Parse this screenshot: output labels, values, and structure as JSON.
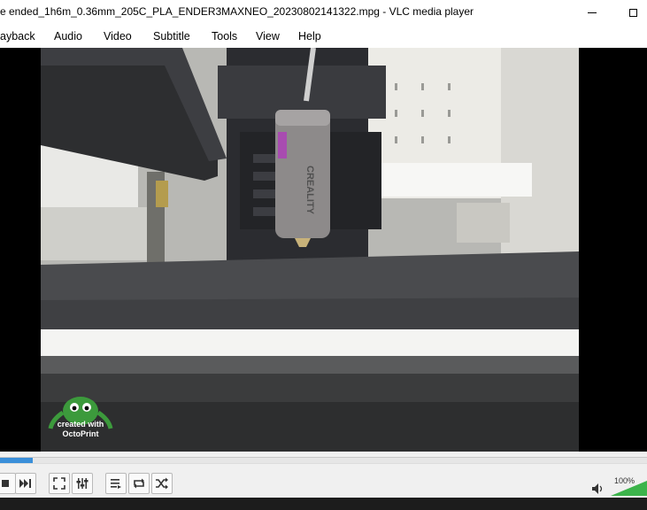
{
  "window": {
    "title": "e ended_1h6m_0.36mm_205C_PLA_ENDER3MAXNEO_20230802141322.mpg - VLC media player"
  },
  "menu": {
    "items": [
      "ayback",
      "Audio",
      "Video",
      "Subtitle",
      "Tools",
      "View",
      "Help"
    ]
  },
  "video": {
    "watermark_line1": "created with",
    "watermark_line2": "OctoPrint",
    "nozzle_brand": "CREALITY"
  },
  "playback": {
    "progress_fraction": 0.05,
    "volume_label": "100%",
    "volume_fraction": 1.0
  },
  "colors": {
    "seek_fill": "#3a8fd9",
    "volume_fill": "#3cb44b",
    "video_background": "#000000"
  },
  "icons": [
    "stop-icon",
    "next-icon",
    "fullscreen-icon",
    "extended-settings-icon",
    "playlist-icon",
    "loop-icon",
    "shuffle-icon",
    "speaker-icon"
  ]
}
